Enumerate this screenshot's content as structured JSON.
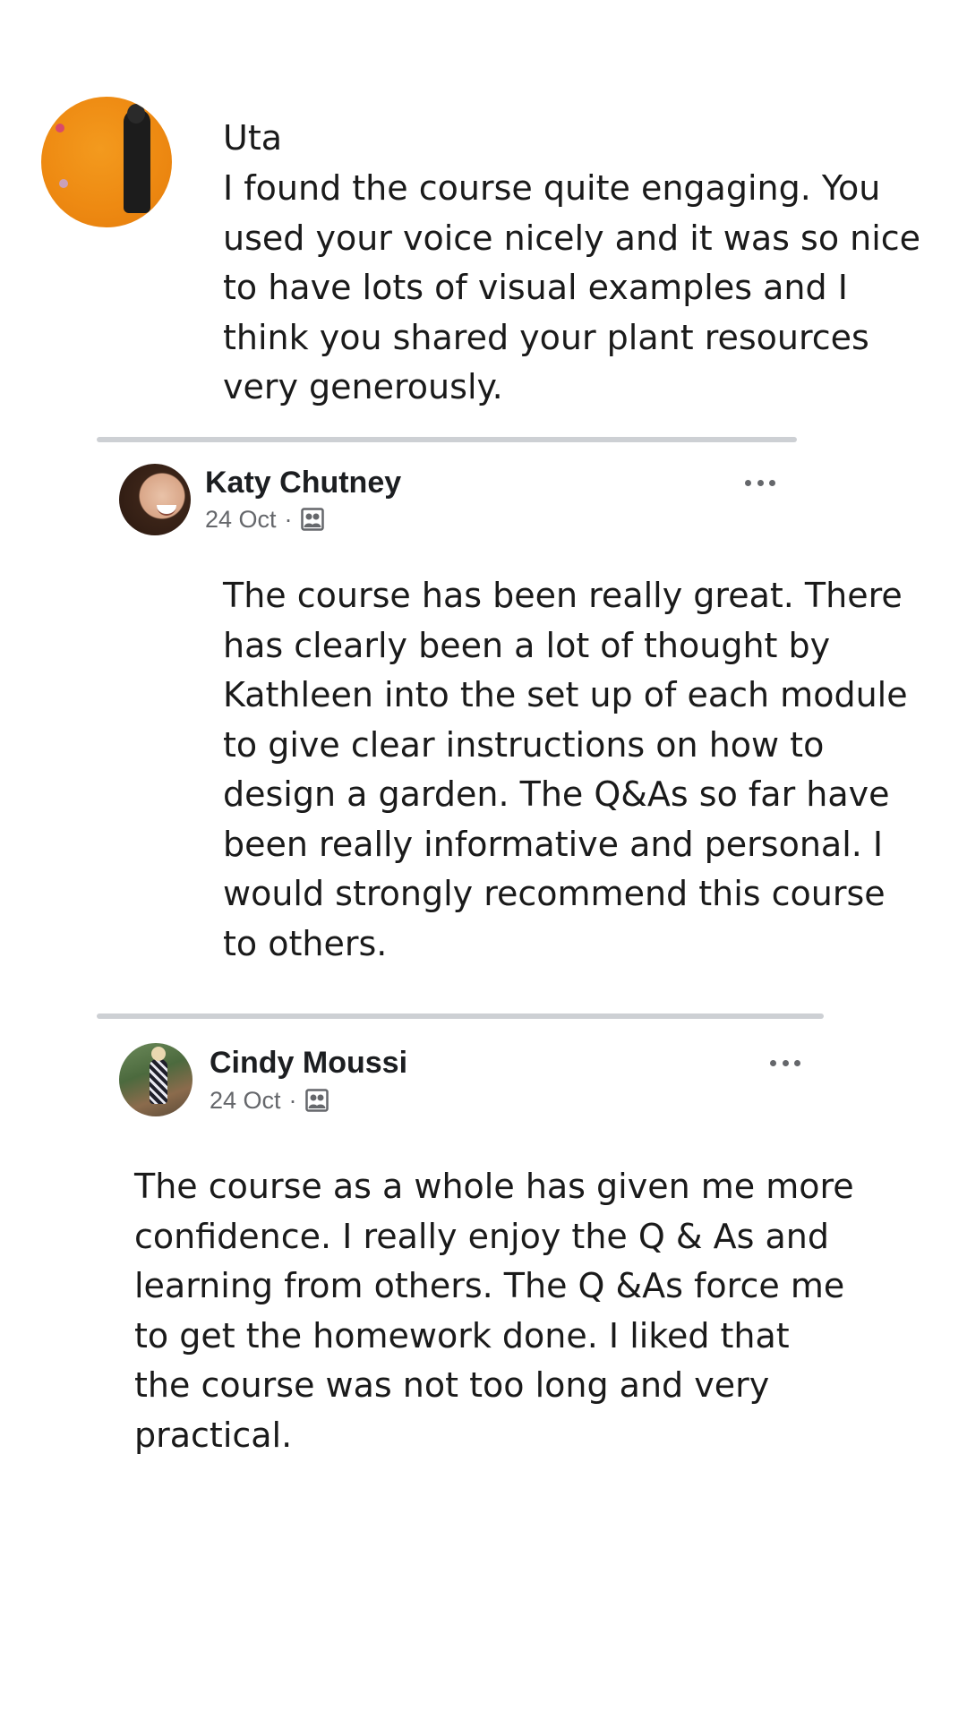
{
  "testimonials": [
    {
      "name": "Uta",
      "lines": [
        "I found the course quite engaging. You",
        "used your voice nicely and it was so nice",
        "to have lots of visual examples and I",
        "think you shared your plant resources",
        "very generously."
      ]
    }
  ],
  "posts": [
    {
      "author": "Katy Chutney",
      "date": "24 Oct",
      "separator": "·",
      "audience_icon": "group-audience-icon",
      "more_icon": "more-options-icon",
      "lines": [
        "The course has been really great. There",
        "has clearly been a lot of thought by",
        "Kathleen into the set up of each module",
        "to give clear instructions on how to",
        "design a garden. The Q&As so far have",
        "been really informative and personal. I",
        "would strongly recommend this course",
        "to others."
      ]
    },
    {
      "author": "Cindy Moussi",
      "date": "24 Oct",
      "separator": "·",
      "audience_icon": "group-audience-icon",
      "more_icon": "more-options-icon",
      "lines": [
        "The course as a whole has given me more",
        "confidence. I really enjoy the Q & As and",
        "learning from others. The Q &As force me",
        "to get the homework done. I liked that",
        "the course was not too long and very",
        "practical."
      ]
    }
  ],
  "colors": {
    "divider": "#cdd0d4",
    "meta_text": "#65676b",
    "name_text": "#1c1e21",
    "body_text": "#1a1a1a",
    "uta_avatar_bg": "#ee8a12"
  }
}
